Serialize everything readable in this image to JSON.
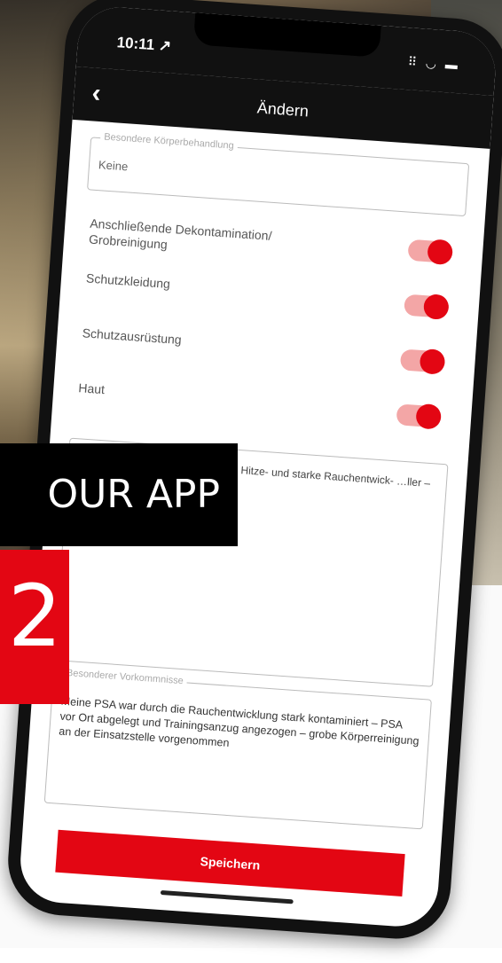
{
  "status": {
    "time": "10:11 ↗",
    "icons": "⠿ ◡ ▬"
  },
  "nav": {
    "back": "‹",
    "title": "Ändern"
  },
  "field_behandlung": {
    "legend": "Besondere Körperbehandlung",
    "value": "Keine"
  },
  "toggles": [
    {
      "label": "Anschließende Dekontamination/ Grobreinigung",
      "on": true
    },
    {
      "label": "Schutzkleidung",
      "on": true
    },
    {
      "label": "Schutzausrüstung",
      "on": true
    },
    {
      "label": "Haut",
      "on": true
    }
  ],
  "description": {
    "text": "…nd im Hochhaus – mehrere …e Hitze- und starke Rauchentwick- …ller – Menschenrettung über"
  },
  "field_kommentar": {
    "legend": "Besonderer Vorkommnisse",
    "value": "Meine PSA war durch die Rauchentwicklung stark kontaminiert – PSA vor Ort abgelegt und Trainingsanzug angezogen – grobe Körperreinigung an der Einsatzstelle vorgenommen"
  },
  "save_label": "Speichern",
  "overlay": {
    "tag": "OUR APP",
    "number": "2"
  },
  "colors": {
    "accent": "#e30613",
    "toggle_track": "#f3a6a6"
  }
}
